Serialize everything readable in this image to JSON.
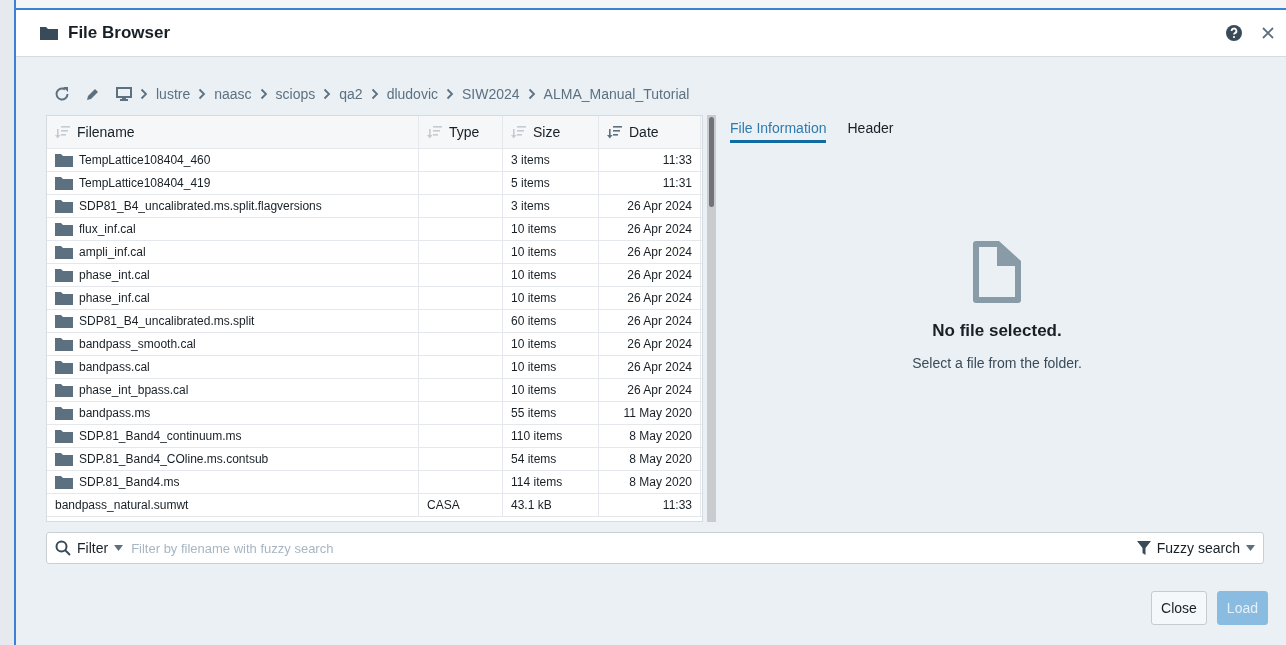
{
  "window": {
    "title": "File Browser"
  },
  "breadcrumb": [
    "lustre",
    "naasc",
    "sciops",
    "qa2",
    "dludovic",
    "SIW2024",
    "ALMA_Manual_Tutorial"
  ],
  "table": {
    "columns": [
      {
        "label": "Filename",
        "sorted": false
      },
      {
        "label": "Type",
        "sorted": false
      },
      {
        "label": "Size",
        "sorted": false
      },
      {
        "label": "Date",
        "sorted": true
      }
    ],
    "rows": [
      {
        "kind": "folder",
        "name": "TempLattice108404_460",
        "type": "",
        "size": "3 items",
        "date": "11:33"
      },
      {
        "kind": "folder",
        "name": "TempLattice108404_419",
        "type": "",
        "size": "5 items",
        "date": "11:31"
      },
      {
        "kind": "folder",
        "name": "SDP81_B4_uncalibrated.ms.split.flagversions",
        "type": "",
        "size": "3 items",
        "date": "26 Apr 2024"
      },
      {
        "kind": "folder",
        "name": "flux_inf.cal",
        "type": "",
        "size": "10 items",
        "date": "26 Apr 2024"
      },
      {
        "kind": "folder",
        "name": "ampli_inf.cal",
        "type": "",
        "size": "10 items",
        "date": "26 Apr 2024"
      },
      {
        "kind": "folder",
        "name": "phase_int.cal",
        "type": "",
        "size": "10 items",
        "date": "26 Apr 2024"
      },
      {
        "kind": "folder",
        "name": "phase_inf.cal",
        "type": "",
        "size": "10 items",
        "date": "26 Apr 2024"
      },
      {
        "kind": "folder",
        "name": "SDP81_B4_uncalibrated.ms.split",
        "type": "",
        "size": "60 items",
        "date": "26 Apr 2024"
      },
      {
        "kind": "folder",
        "name": "bandpass_smooth.cal",
        "type": "",
        "size": "10 items",
        "date": "26 Apr 2024"
      },
      {
        "kind": "folder",
        "name": "bandpass.cal",
        "type": "",
        "size": "10 items",
        "date": "26 Apr 2024"
      },
      {
        "kind": "folder",
        "name": "phase_int_bpass.cal",
        "type": "",
        "size": "10 items",
        "date": "26 Apr 2024"
      },
      {
        "kind": "folder",
        "name": "bandpass.ms",
        "type": "",
        "size": "55 items",
        "date": "11 May 2020"
      },
      {
        "kind": "folder",
        "name": "SDP.81_Band4_continuum.ms",
        "type": "",
        "size": "110 items",
        "date": "8 May 2020"
      },
      {
        "kind": "folder",
        "name": "SDP.81_Band4_COline.ms.contsub",
        "type": "",
        "size": "54 items",
        "date": "8 May 2020"
      },
      {
        "kind": "folder",
        "name": "SDP.81_Band4.ms",
        "type": "",
        "size": "114 items",
        "date": "8 May 2020"
      },
      {
        "kind": "file",
        "name": "bandpass_natural.sumwt",
        "type": "CASA",
        "size": "43.1 kB",
        "date": "11:33"
      }
    ]
  },
  "info_tabs": [
    {
      "label": "File Information",
      "selected": true
    },
    {
      "label": "Header",
      "selected": false
    }
  ],
  "empty_state": {
    "title": "No file selected.",
    "message": "Select a file from the folder."
  },
  "filter": {
    "label": "Filter",
    "placeholder": "Filter by filename with fuzzy search",
    "mode": "Fuzzy search"
  },
  "buttons": [
    {
      "label": "Close",
      "disabled": false
    },
    {
      "label": "Load",
      "disabled": true
    }
  ]
}
